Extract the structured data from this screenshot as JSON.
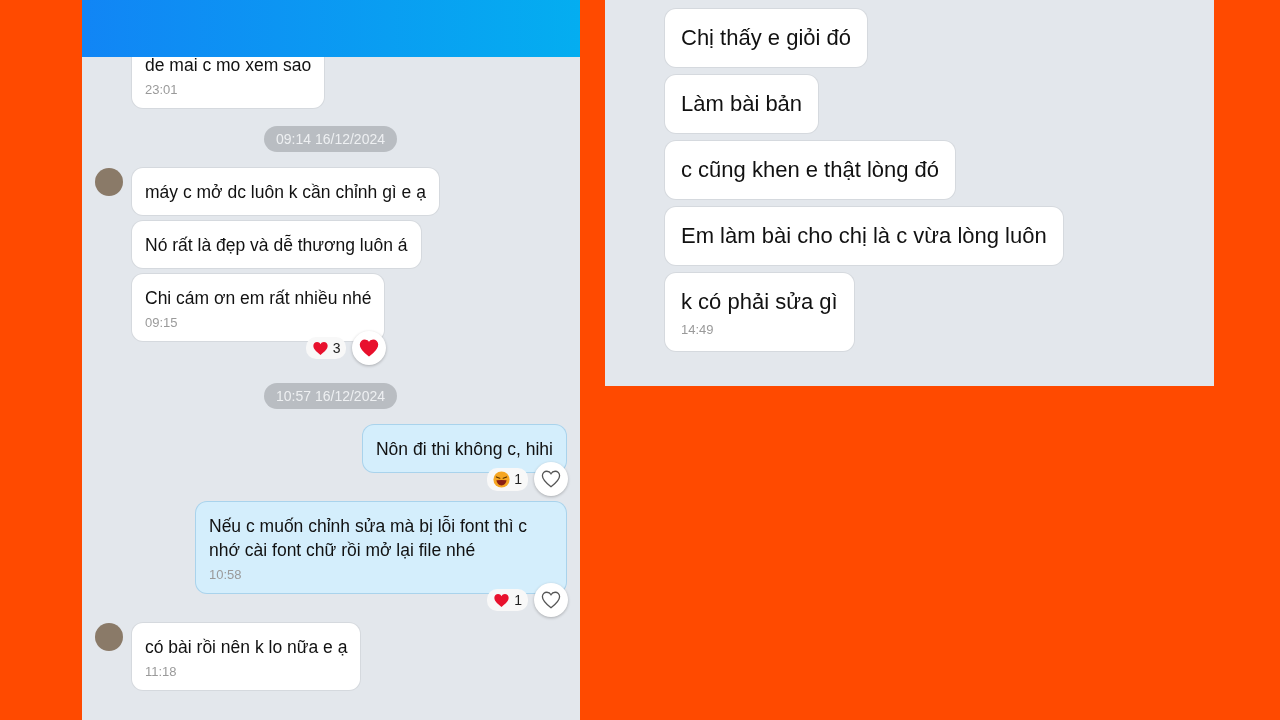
{
  "left_chat": {
    "items": [
      {
        "kind": "incoming",
        "avatar": false,
        "text": "de mai c mo xem sao",
        "time": "23:01"
      },
      {
        "kind": "date",
        "text": "09:14 16/12/2024"
      },
      {
        "kind": "incoming",
        "avatar": true,
        "text": "máy c mở dc luôn k cần chỉnh gì e ạ"
      },
      {
        "kind": "incoming",
        "avatar": false,
        "text": "Nó rất là đẹp và dễ thương luôn á"
      },
      {
        "kind": "incoming",
        "avatar": false,
        "text": "Chi cám ơn em rất nhiều nhé",
        "time": "09:15",
        "reaction": {
          "kind": "heart",
          "count": "3"
        },
        "liked": true
      },
      {
        "kind": "date",
        "text": "10:57 16/12/2024"
      },
      {
        "kind": "outgoing",
        "text": "Nôn đi thi không c, hihi",
        "reaction": {
          "kind": "laugh",
          "count": "1"
        },
        "liked": false
      },
      {
        "kind": "outgoing",
        "text": "Nếu c muốn chỉnh sửa mà bị lỗi font thì c nhớ cài font chữ rồi mở lại file nhé",
        "time": "10:58",
        "reaction": {
          "kind": "heart",
          "count": "1"
        },
        "liked": false
      },
      {
        "kind": "incoming",
        "avatar": true,
        "text": "có bài rồi nên k lo nữa e ạ",
        "time": "11:18"
      }
    ]
  },
  "right_chat": {
    "items": [
      {
        "kind": "incoming",
        "text": "Chị thấy e giỏi đó"
      },
      {
        "kind": "incoming",
        "text": "Làm bài bản"
      },
      {
        "kind": "incoming",
        "text": "c cũng khen e thật lòng đó"
      },
      {
        "kind": "incoming",
        "text": "Em làm bài cho chị là c vừa lòng luôn"
      },
      {
        "kind": "incoming",
        "text": "k có phải sửa gì",
        "time": "14:49"
      }
    ]
  }
}
